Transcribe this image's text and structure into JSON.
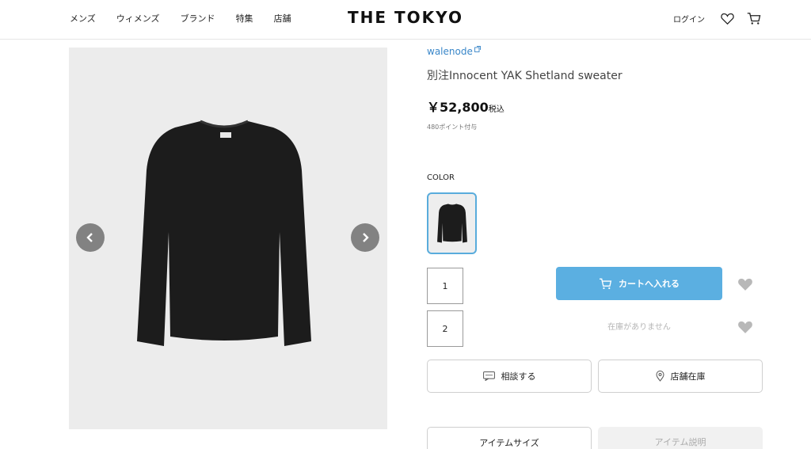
{
  "header": {
    "nav": [
      "メンズ",
      "ウィメンズ",
      "ブランド",
      "特集",
      "店舗"
    ],
    "logo": "THE TOKYO",
    "login": "ログイン"
  },
  "product": {
    "brand": "walenode",
    "title": "別注Innocent YAK Shetland sweater",
    "price": "￥52,800",
    "tax_label": "税込",
    "points": "480ポイント付与",
    "color_label": "COLOR",
    "quantities": [
      "1",
      "2"
    ],
    "cart_button": "カートへ入れる",
    "out_of_stock": "在庫がありません",
    "consult_button": "相談する",
    "store_stock_button": "店舗在庫",
    "tabs": [
      "アイテムサイズ",
      "アイテム説明"
    ]
  },
  "colors": {
    "accent": "#5bafe1",
    "brand_link": "#3a87c9",
    "gallery_bg": "#ececec",
    "sweater": "#1c1c1c"
  },
  "icons": [
    "heart-icon",
    "cart-icon",
    "chevron-left-icon",
    "chevron-right-icon",
    "chat-icon",
    "location-pin-icon",
    "external-link-icon"
  ]
}
